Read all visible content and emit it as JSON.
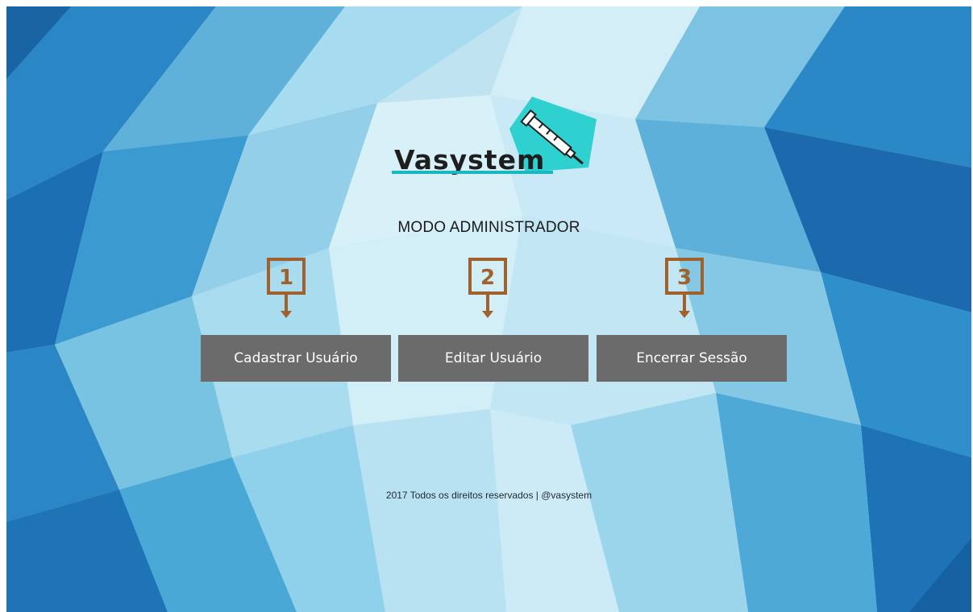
{
  "brand": {
    "name": "Vasystem",
    "icon": "syringe-icon",
    "accent_color": "#2fd0d0"
  },
  "header": {
    "mode_title": "MODO ADMINISTRADOR"
  },
  "markers": [
    {
      "number": "1",
      "color": "#a0612c"
    },
    {
      "number": "2",
      "color": "#a0612c"
    },
    {
      "number": "3",
      "color": "#a0612c"
    }
  ],
  "actions": [
    {
      "label": "Cadastrar Usuário"
    },
    {
      "label": "Editar Usuário"
    },
    {
      "label": "Encerrar Sessão"
    }
  ],
  "footer": {
    "text": "2017 Todos os direitos reservados | @vasystem"
  },
  "colors": {
    "button_bg": "#6b6b6b",
    "button_text": "#ffffff",
    "background": "#bfe3f1"
  }
}
